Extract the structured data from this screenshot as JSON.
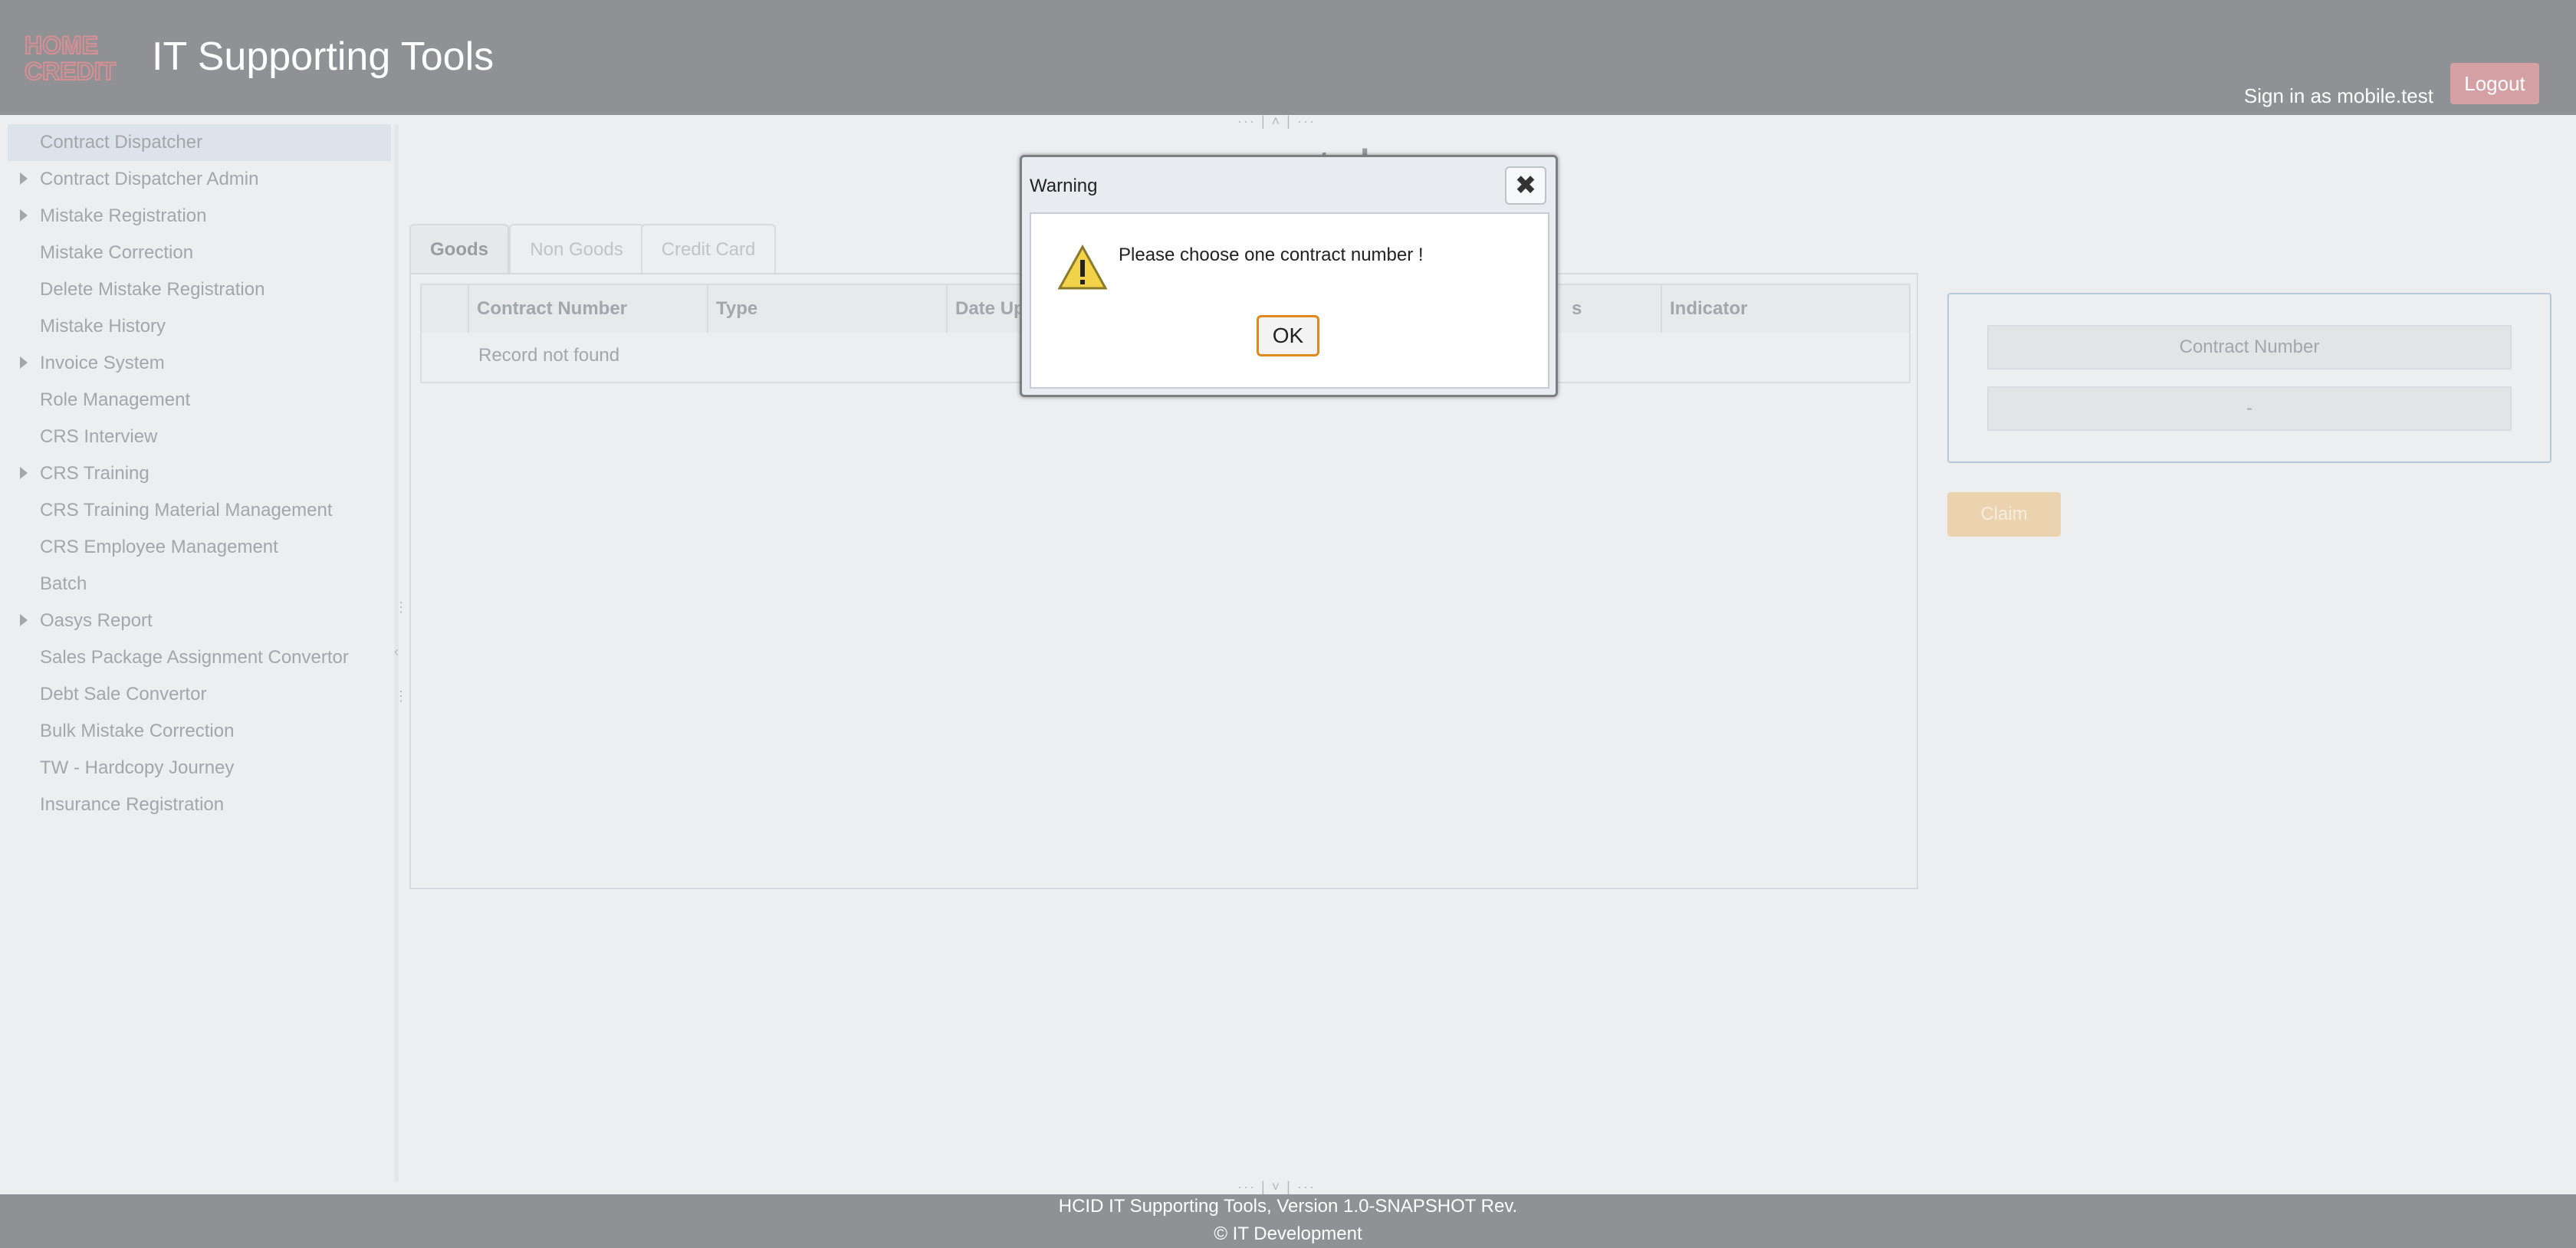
{
  "header": {
    "logo_text": [
      "HOME",
      "CREDIT"
    ],
    "app_title": "IT Supporting Tools",
    "signin_text": "Sign in as mobile.test",
    "logout_label": "Logout"
  },
  "sidebar": {
    "items": [
      {
        "label": "Contract Dispatcher",
        "expandable": false,
        "active": true
      },
      {
        "label": "Contract Dispatcher Admin",
        "expandable": true
      },
      {
        "label": "Mistake Registration",
        "expandable": true
      },
      {
        "label": "Mistake Correction",
        "expandable": false
      },
      {
        "label": "Delete Mistake Registration",
        "expandable": false
      },
      {
        "label": "Mistake History",
        "expandable": false
      },
      {
        "label": "Invoice System",
        "expandable": true
      },
      {
        "label": "Role Management",
        "expandable": false
      },
      {
        "label": "CRS Interview",
        "expandable": false
      },
      {
        "label": "CRS Training",
        "expandable": true
      },
      {
        "label": "CRS Training Material Management",
        "expandable": false
      },
      {
        "label": "CRS Employee Management",
        "expandable": false
      },
      {
        "label": "Batch",
        "expandable": false
      },
      {
        "label": "Oasys Report",
        "expandable": true
      },
      {
        "label": "Sales Package Assignment Convertor",
        "expandable": false
      },
      {
        "label": "Debt Sale Convertor",
        "expandable": false
      },
      {
        "label": "Bulk Mistake Correction",
        "expandable": false
      },
      {
        "label": "TW - Hardcopy Journey",
        "expandable": false
      },
      {
        "label": "Insurance Registration",
        "expandable": false
      }
    ]
  },
  "main": {
    "page_title_visible": "patcher",
    "tabs": [
      {
        "label": "Goods",
        "active": true
      },
      {
        "label": "Non Goods",
        "active": false
      },
      {
        "label": "Credit Card",
        "active": false
      }
    ],
    "table": {
      "columns": [
        "Contract Number",
        "Type",
        "Date Up",
        "s",
        "Indicator"
      ],
      "empty_message": "Record not found"
    },
    "info_card": {
      "label": "Contract Number",
      "value": "-"
    },
    "claim_label": "Claim"
  },
  "dialog": {
    "title": "Warning",
    "message": "Please choose one contract number !",
    "ok_label": "OK",
    "close_icon": "close-icon",
    "warning_icon": "warning-triangle-icon"
  },
  "footer": {
    "line1": "HCID IT Supporting Tools, Version 1.0-SNAPSHOT Rev.",
    "line2": "© IT Development"
  },
  "colors": {
    "header_bg": "#8f9195",
    "logo_accent": "#d88f94",
    "logout_bg": "#d4a0a3",
    "claim_bg": "#ecd3b0",
    "ok_border": "#e08a1e"
  }
}
